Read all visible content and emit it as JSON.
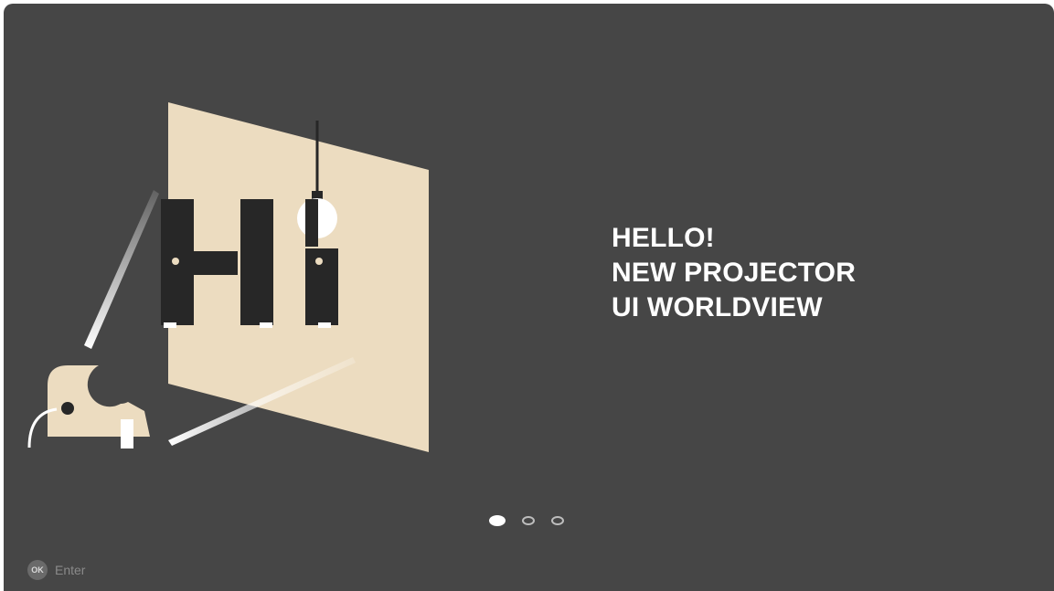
{
  "headline": {
    "line1": "HELLO!",
    "line2": "NEW PROJECTOR",
    "line3": "UI WORLDVIEW"
  },
  "pager": {
    "total": 3,
    "current": 1
  },
  "hint": {
    "button": "OK",
    "label": "Enter"
  },
  "colors": {
    "background": "#464646",
    "screen_panel": "#ecdcc0",
    "letters": "#272727",
    "text": "#ffffff"
  },
  "icons": {
    "illustration": "projector-hi-illustration",
    "lamp": "light-bulb-icon"
  }
}
